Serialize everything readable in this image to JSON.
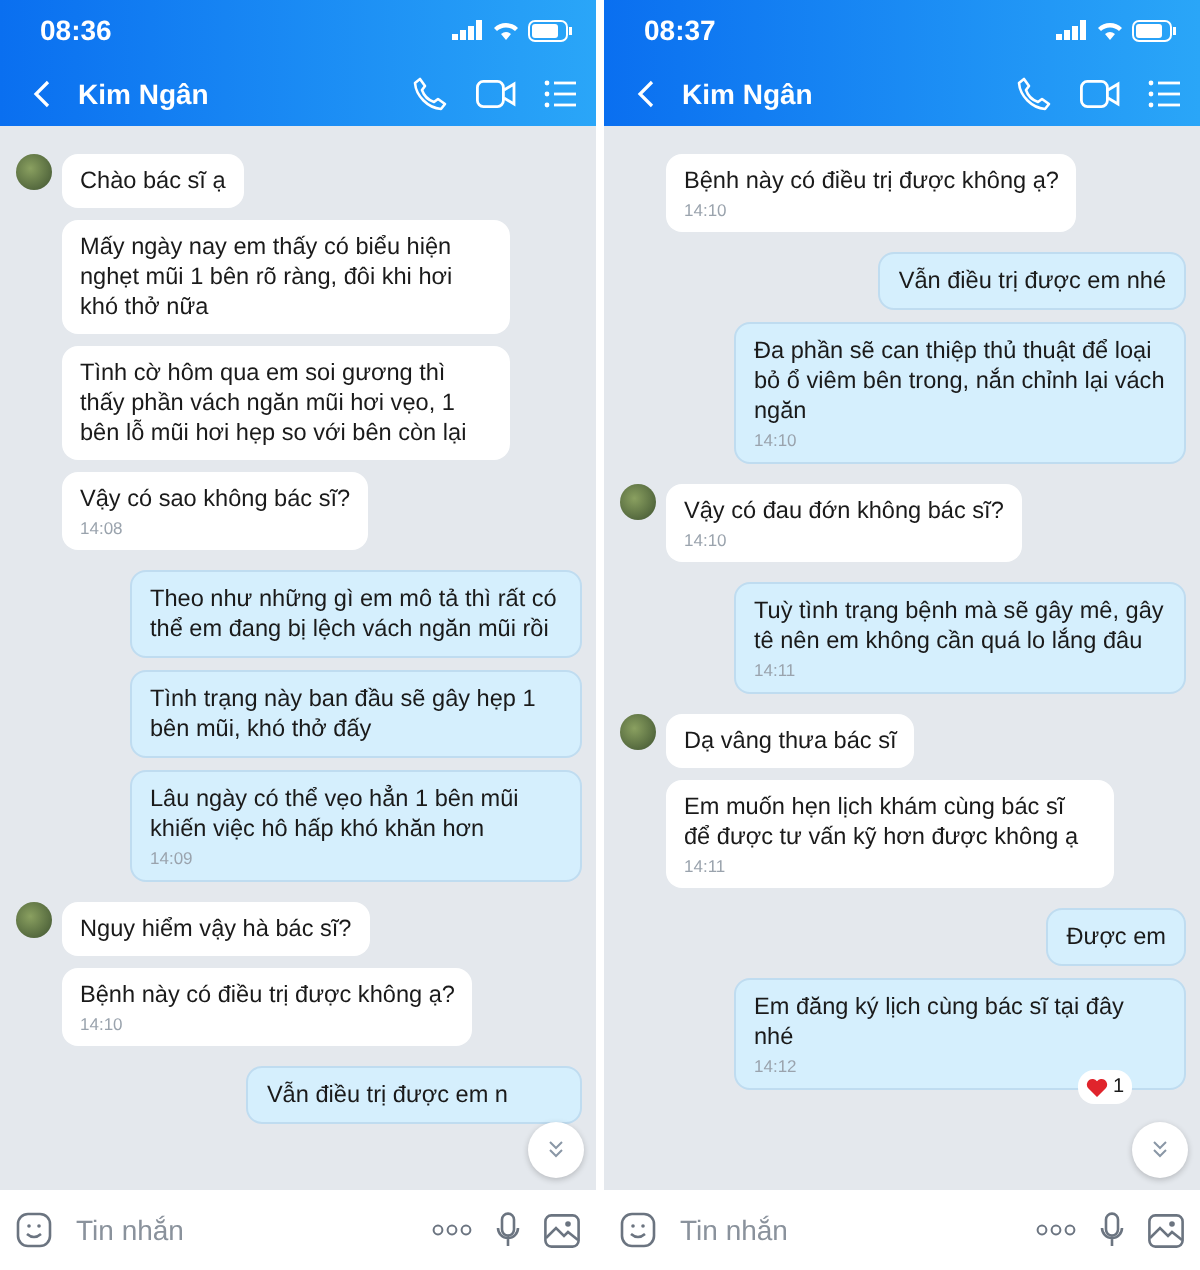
{
  "screens": [
    {
      "status_time": "08:36",
      "contact_name": "Kim Ngân",
      "input_placeholder": "Tin nhắn",
      "messages": [
        {
          "kind": "incoming",
          "avatar": true,
          "text": "Chào bác sĩ ạ"
        },
        {
          "kind": "incoming",
          "avatar": false,
          "text": "Mấy ngày nay em thấy có biểu hiện nghẹt mũi 1 bên rõ ràng, đôi khi hơi khó thở nữa"
        },
        {
          "kind": "incoming",
          "avatar": false,
          "text": "Tình cờ hôm qua em soi gương thì thấy phần vách ngăn mũi hơi vẹo, 1 bên lỗ mũi hơi hẹp so với bên còn lại"
        },
        {
          "kind": "incoming",
          "avatar": false,
          "text": "Vậy có sao không bác sĩ?",
          "time": "14:08"
        },
        {
          "kind": "outgoing",
          "text": "Theo như những gì em mô tả thì rất có thể em đang bị lệch vách ngăn mũi rồi"
        },
        {
          "kind": "outgoing",
          "text": "Tình trạng này ban đầu sẽ gây hẹp 1 bên mũi, khó thở đấy"
        },
        {
          "kind": "outgoing",
          "text": "Lâu ngày có thể vẹo hẳn 1 bên mũi khiến việc hô hấp khó khăn hơn",
          "time": "14:09"
        },
        {
          "kind": "incoming",
          "avatar": true,
          "text": "Nguy hiểm vậy hà bác sĩ?"
        },
        {
          "kind": "incoming",
          "avatar": false,
          "text": "Bệnh này có điều trị được không ạ?",
          "time": "14:10"
        },
        {
          "kind": "outgoing",
          "text": "Vẫn điều trị được em n"
        }
      ]
    },
    {
      "status_time": "08:37",
      "contact_name": "Kim Ngân",
      "input_placeholder": "Tin nhắn",
      "messages": [
        {
          "kind": "incoming",
          "avatar": false,
          "text": "Bệnh này có điều trị được không ạ?",
          "time": "14:10"
        },
        {
          "kind": "outgoing",
          "text": "Vẫn điều trị được em nhé"
        },
        {
          "kind": "outgoing",
          "text": "Đa phần sẽ can thiệp thủ thuật để loại bỏ ổ viêm bên trong, nắn chỉnh lại vách ngăn",
          "time": "14:10"
        },
        {
          "kind": "incoming",
          "avatar": true,
          "text": "Vậy có đau đớn không bác sĩ?",
          "time": "14:10"
        },
        {
          "kind": "outgoing",
          "text": "Tuỳ tình trạng bệnh mà sẽ gây mê, gây tê nên em không cần quá lo lắng đâu",
          "time": "14:11"
        },
        {
          "kind": "incoming",
          "avatar": true,
          "text": "Dạ vâng thưa bác sĩ"
        },
        {
          "kind": "incoming",
          "avatar": false,
          "text": "Em muốn hẹn lịch khám cùng bác sĩ để được tư vấn kỹ hơn được không ạ",
          "time": "14:11"
        },
        {
          "kind": "outgoing",
          "text": "Được em"
        },
        {
          "kind": "outgoing",
          "text": "Em đăng ký lịch cùng bác sĩ tại đây nhé",
          "time": "14:12",
          "reaction": "1"
        }
      ]
    }
  ]
}
